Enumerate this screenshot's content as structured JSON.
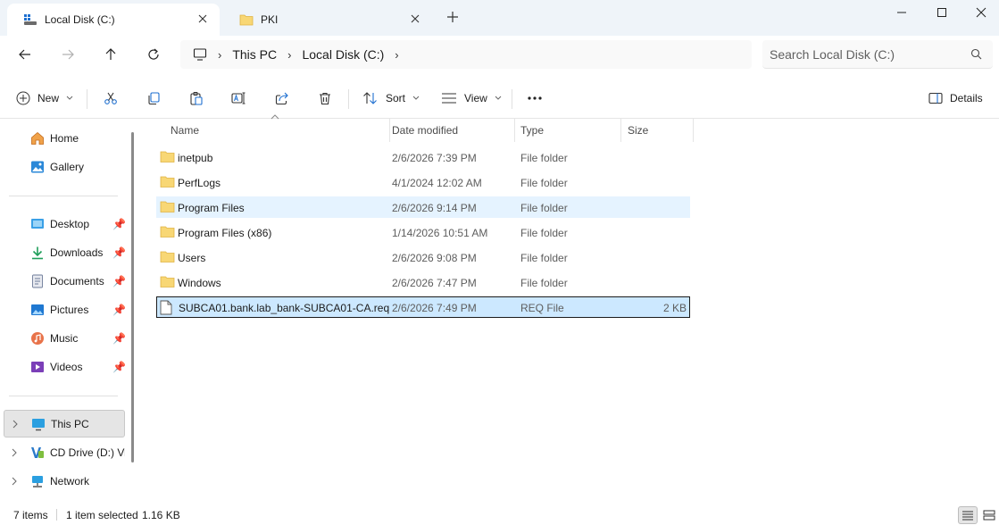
{
  "tabs": [
    {
      "label": "Local Disk (C:)",
      "icon": "drive-icon",
      "active": true
    },
    {
      "label": "PKI",
      "icon": "folder-icon",
      "active": false
    }
  ],
  "address": {
    "segments": [
      "This PC",
      "Local Disk (C:)"
    ]
  },
  "search": {
    "placeholder": "Search Local Disk (C:)"
  },
  "toolbar": {
    "new_label": "New",
    "sort_label": "Sort",
    "view_label": "View",
    "details_label": "Details"
  },
  "nav": {
    "home": "Home",
    "gallery": "Gallery",
    "desktop": "Desktop",
    "downloads": "Downloads",
    "documents": "Documents",
    "pictures": "Pictures",
    "music": "Music",
    "videos": "Videos",
    "this_pc": "This PC",
    "cd_drive": "CD Drive (D:) Vir",
    "network": "Network"
  },
  "columns": {
    "name": "Name",
    "date": "Date modified",
    "type": "Type",
    "size": "Size"
  },
  "files": [
    {
      "name": "inetpub",
      "date": "2/6/2026 7:39 PM",
      "type": "File folder",
      "size": ""
    },
    {
      "name": "PerfLogs",
      "date": "4/1/2024 12:02 AM",
      "type": "File folder",
      "size": ""
    },
    {
      "name": "Program Files",
      "date": "2/6/2026 9:14 PM",
      "type": "File folder",
      "size": ""
    },
    {
      "name": "Program Files (x86)",
      "date": "1/14/2026 10:51 AM",
      "type": "File folder",
      "size": ""
    },
    {
      "name": "Users",
      "date": "2/6/2026 9:08 PM",
      "type": "File folder",
      "size": ""
    },
    {
      "name": "Windows",
      "date": "2/6/2026 7:47 PM",
      "type": "File folder",
      "size": ""
    },
    {
      "name": "SUBCA01.bank.lab_bank-SUBCA01-CA.req",
      "date": "2/6/2026 7:49 PM",
      "type": "REQ File",
      "size": "2 KB"
    }
  ],
  "status": {
    "items": "7 items",
    "selected": "1 item selected",
    "size": "1.16 KB"
  },
  "colors": {
    "accent": "#0067c0",
    "folder": "#f8d775",
    "selection": "#cce8ff",
    "hover": "#e5f3ff"
  }
}
